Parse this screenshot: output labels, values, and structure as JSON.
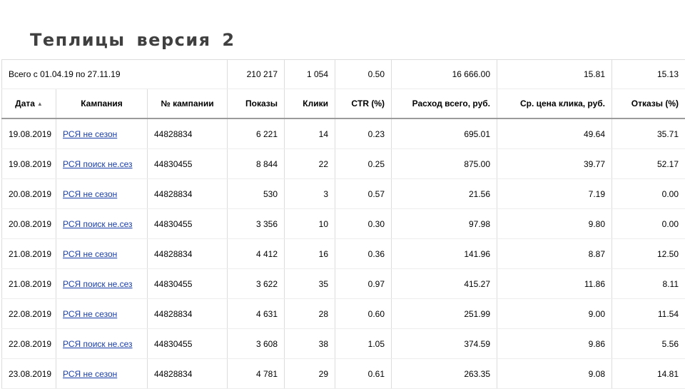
{
  "title": "Теплицы версия 2",
  "total": {
    "label": "Всего с 01.04.19 по 27.11.19",
    "impressions": "210 217",
    "clicks": "1 054",
    "ctr": "0.50",
    "cost": "16 666.00",
    "cpc": "15.81",
    "bounce": "15.13"
  },
  "columns": {
    "date": "Дата",
    "campaign": "Кампания",
    "campaign_id": "№ кампании",
    "impressions": "Показы",
    "clicks": "Клики",
    "ctr": "CTR (%)",
    "cost": "Расход всего, руб.",
    "cpc": "Ср. цена клика, руб.",
    "bounce": "Отказы (%)"
  },
  "sort_icon": "triangle-up",
  "rows": [
    {
      "date": "19.08.2019",
      "campaign": "РСЯ не сезон",
      "campaign_id": "44828834",
      "impressions": "6 221",
      "clicks": "14",
      "ctr": "0.23",
      "cost": "695.01",
      "cpc": "49.64",
      "bounce": "35.71"
    },
    {
      "date": "19.08.2019",
      "campaign": "РСЯ поиск не.сез",
      "campaign_id": "44830455",
      "impressions": "8 844",
      "clicks": "22",
      "ctr": "0.25",
      "cost": "875.00",
      "cpc": "39.77",
      "bounce": "52.17"
    },
    {
      "date": "20.08.2019",
      "campaign": "РСЯ не сезон",
      "campaign_id": "44828834",
      "impressions": "530",
      "clicks": "3",
      "ctr": "0.57",
      "cost": "21.56",
      "cpc": "7.19",
      "bounce": "0.00"
    },
    {
      "date": "20.08.2019",
      "campaign": "РСЯ поиск не.сез",
      "campaign_id": "44830455",
      "impressions": "3 356",
      "clicks": "10",
      "ctr": "0.30",
      "cost": "97.98",
      "cpc": "9.80",
      "bounce": "0.00"
    },
    {
      "date": "21.08.2019",
      "campaign": "РСЯ не сезон",
      "campaign_id": "44828834",
      "impressions": "4 412",
      "clicks": "16",
      "ctr": "0.36",
      "cost": "141.96",
      "cpc": "8.87",
      "bounce": "12.50"
    },
    {
      "date": "21.08.2019",
      "campaign": "РСЯ поиск не.сез",
      "campaign_id": "44830455",
      "impressions": "3 622",
      "clicks": "35",
      "ctr": "0.97",
      "cost": "415.27",
      "cpc": "11.86",
      "bounce": "8.11"
    },
    {
      "date": "22.08.2019",
      "campaign": "РСЯ не сезон",
      "campaign_id": "44828834",
      "impressions": "4 631",
      "clicks": "28",
      "ctr": "0.60",
      "cost": "251.99",
      "cpc": "9.00",
      "bounce": "11.54"
    },
    {
      "date": "22.08.2019",
      "campaign": "РСЯ поиск не.сез",
      "campaign_id": "44830455",
      "impressions": "3 608",
      "clicks": "38",
      "ctr": "1.05",
      "cost": "374.59",
      "cpc": "9.86",
      "bounce": "5.56"
    },
    {
      "date": "23.08.2019",
      "campaign": "РСЯ не сезон",
      "campaign_id": "44828834",
      "impressions": "4 781",
      "clicks": "29",
      "ctr": "0.61",
      "cost": "263.35",
      "cpc": "9.08",
      "bounce": "14.81"
    }
  ]
}
